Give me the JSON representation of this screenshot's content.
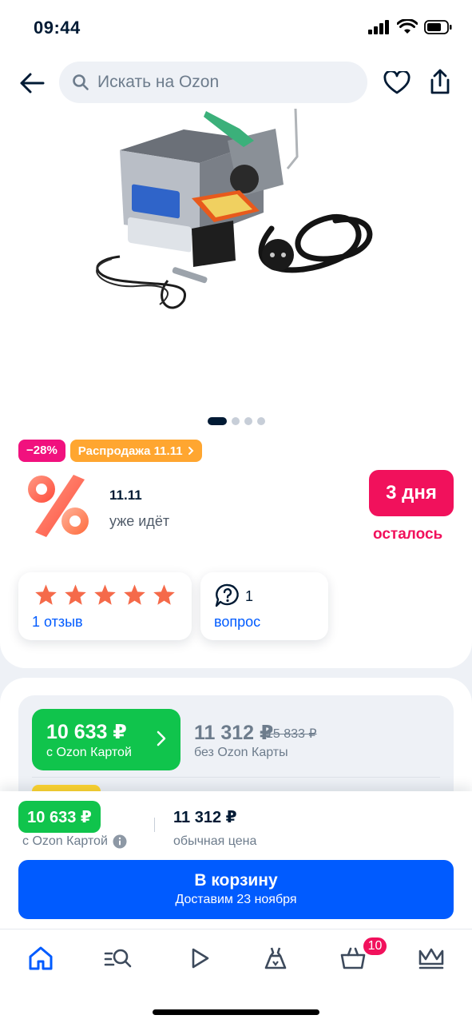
{
  "status_bar": {
    "time": "09:44"
  },
  "header": {
    "search_placeholder": "Искать на Ozon"
  },
  "gallery": {
    "image_count": 4,
    "active_index": 0
  },
  "badges": {
    "discount": "−28%",
    "sale": "Распродажа 11.11"
  },
  "promo": {
    "title": "11.11",
    "subtitle": "уже идёт",
    "days": "3 дня",
    "days_caption": "осталось"
  },
  "reviews": {
    "stars": 5,
    "reviews_label": "1 отзыв",
    "questions_count": "1",
    "questions_label": "вопрос"
  },
  "price": {
    "card_price": "10 633 ₽",
    "card_label": "с Ozon Картой",
    "regular_price": "11 312 ₽",
    "old_price": "15 833 ₽",
    "regular_label": "без Ozon Карты"
  },
  "sticky": {
    "card_price": "10 633 ₽",
    "card_label": "с Ozon Картой",
    "regular_price": "11 312 ₽",
    "regular_label": "обычная цена",
    "cart_button": "В корзину",
    "delivery": "Доставим 23 ноября"
  },
  "tabbar": {
    "cart_badge": "10"
  },
  "colors": {
    "accent": "#005bff",
    "green": "#10c44c",
    "pink": "#f1115c",
    "orange": "#ffa630"
  }
}
